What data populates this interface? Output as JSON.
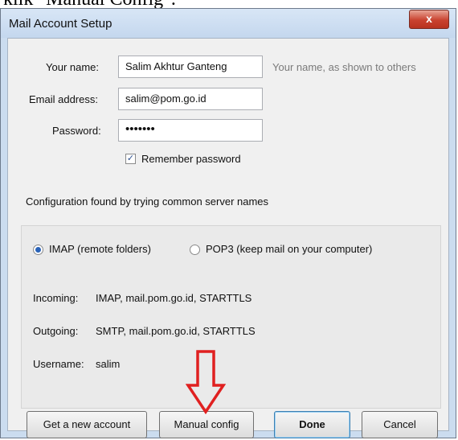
{
  "caption": "klik \"Manual Config\".",
  "window": {
    "title": "Mail Account Setup",
    "close_glyph": "x"
  },
  "form": {
    "name_label": "Your name:",
    "name_value": "Salim Akhtur Ganteng",
    "name_hint": "Your name, as shown to others",
    "email_label": "Email address:",
    "email_value": "salim@pom.go.id",
    "password_label": "Password:",
    "password_value": "•••••••",
    "remember_label": "Remember password",
    "remember_checked": true
  },
  "status_text": "Configuration found by trying common server names",
  "protocol": {
    "imap_label": "IMAP (remote folders)",
    "pop3_label": "POP3 (keep mail on your computer)",
    "selected": "imap"
  },
  "server_info": {
    "incoming_label": "Incoming:",
    "incoming_value": "IMAP, mail.pom.go.id, STARTTLS",
    "outgoing_label": "Outgoing:",
    "outgoing_value": "SMTP, mail.pom.go.id, STARTTLS",
    "username_label": "Username:",
    "username_value": "salim"
  },
  "buttons": {
    "new_account": "Get a new account",
    "manual_config": "Manual config",
    "done": "Done",
    "cancel": "Cancel"
  },
  "colors": {
    "annotation_arrow": "#e02020",
    "window_frame": "#cbdcef",
    "close_button": "#c9422f"
  },
  "icons": {
    "annotation": "red-down-arrow-icon",
    "checkbox": "check-icon",
    "close": "close-icon"
  }
}
